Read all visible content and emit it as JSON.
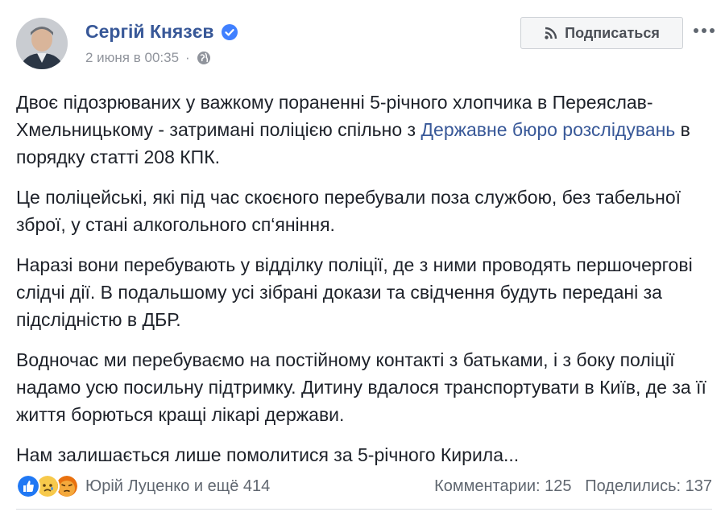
{
  "header": {
    "author": "Сергій Князєв",
    "date": "2 июня в 00:35",
    "separator": "·",
    "subscribe_label": "Подписаться"
  },
  "post": {
    "p1_before_link": "Двоє підозрюваних у важкому пораненні 5-річного хлопчика в Переяслав-Хмельницькому - затримані поліцією спільно з ",
    "p1_link": "Державне бюро розслідувань",
    "p1_after_link": " в порядку статті 208 КПК.",
    "p2": "Це поліцейські, які під час скоєного перебували поза службою, без табельної зброї, у стані алкогольного сп‘яніння.",
    "p3": "Наразі вони перебувають у відділку поліції, де з ними проводять першочергові слідчі дії. В подальшому усі зібрані докази та свідчення будуть передані за підслідністю в ДБР.",
    "p4": "Водночас ми перебуваємо на постійному контакті з батьками, і з боку поліції надамо усю посильну підтримку. Дитину вдалося транспортувати в Київ, де за її життя борються кращі лікарі держави.",
    "p5": "Нам залишається лише помолитися за 5-річного Кирила..."
  },
  "footer": {
    "reactions": [
      {
        "icon": "like-reaction-icon",
        "color": "#2078f4"
      },
      {
        "icon": "sad-reaction-icon",
        "color": "#f7c94b"
      },
      {
        "icon": "angry-reaction-icon",
        "color": "#e9710f"
      }
    ],
    "reactors": "Юрій Луценко и ещё 414",
    "comments": "Комментарии: 125",
    "shares": "Поделились: 137"
  },
  "colors": {
    "link": "#385898",
    "muted": "#90949c",
    "text": "#1d2129"
  }
}
